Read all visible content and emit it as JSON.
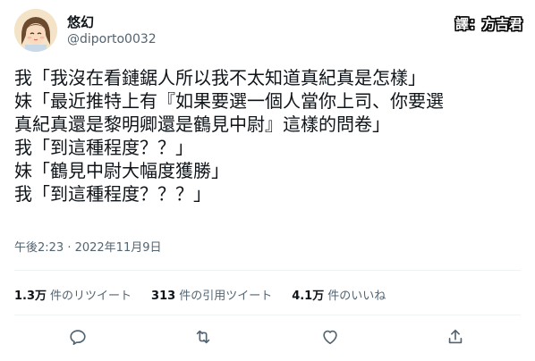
{
  "author": {
    "display_name": "悠幻",
    "handle": "@diporto0032"
  },
  "translator_credit": "譯：方吉君",
  "tweet": {
    "lines": [
      "我「我沒在看鏈鋸人所以我不太知道真紀真是怎樣」",
      "妹「最近推特上有『如果要選一個人當你上司、你要選",
      "真紀真還是黎明卿還是鶴見中尉』這樣的問卷」",
      "我「到這種程度？？」",
      "妹「鶴見中尉大幅度獲勝」",
      "我「到這種程度？？？」"
    ],
    "timestamp": "午後2:23 · 2022年11月9日"
  },
  "stats": {
    "retweets": {
      "count": "1.3万",
      "label": "件のリツイート"
    },
    "quotes": {
      "count": "313",
      "label": "件の引用ツイート"
    },
    "likes": {
      "count": "4.1万",
      "label": "件のいいね"
    }
  },
  "actions": {
    "icons": [
      "reply-icon",
      "retweet-icon",
      "like-icon",
      "share-icon"
    ],
    "color": "#536471"
  }
}
